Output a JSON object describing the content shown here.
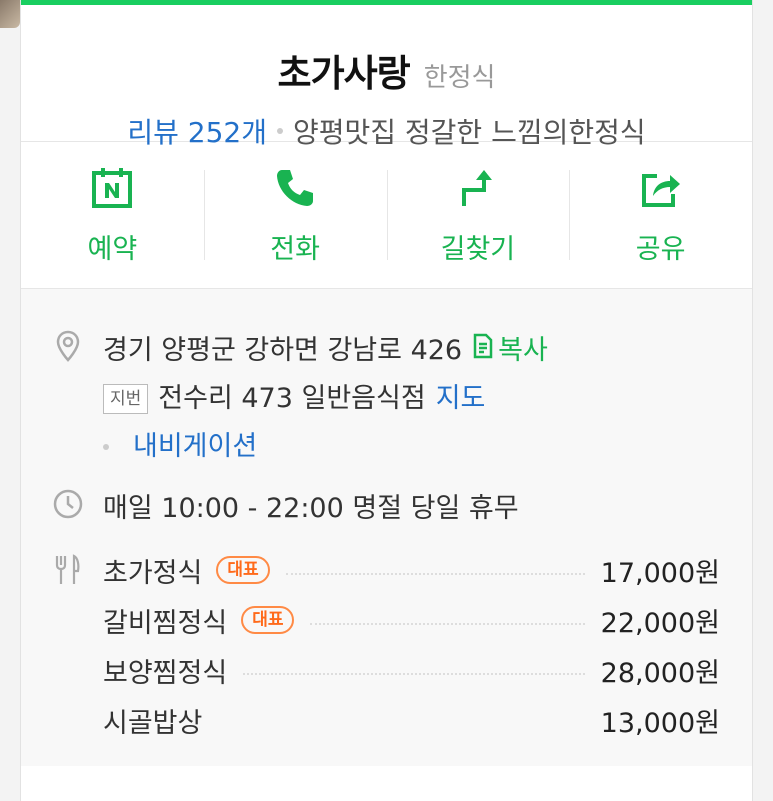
{
  "place": {
    "name": "초가사랑",
    "category": "한정식",
    "review": "리뷰 252개",
    "description": "양평맛집 정갈한 느낌의한정식"
  },
  "actions": [
    {
      "label": "예약",
      "icon": "naver-booking-icon"
    },
    {
      "label": "전화",
      "icon": "phone-icon"
    },
    {
      "label": "길찾기",
      "icon": "directions-icon"
    },
    {
      "label": "공유",
      "icon": "share-icon"
    }
  ],
  "address": {
    "road": "경기 양평군 강하면 강남로 426",
    "copy_label": "복사",
    "lot_badge": "지번",
    "lot": "전수리 473 일반음식점",
    "map_label": "지도",
    "navi_label": "내비게이션"
  },
  "hours": {
    "text": "매일 10:00 - 22:00 명절 당일 휴무"
  },
  "menu": [
    {
      "name": "초가정식",
      "badge": "대표",
      "price": "17,000원"
    },
    {
      "name": "갈비찜정식",
      "badge": "대표",
      "price": "22,000원"
    },
    {
      "name": "보양찜정식",
      "badge": "",
      "price": "28,000원"
    },
    {
      "name": "시골밥상",
      "badge": "",
      "price": "13,000원"
    }
  ],
  "colors": {
    "accent_green": "#19ce60",
    "link_blue": "#2370c9",
    "badge_orange": "#ff6a1a"
  }
}
